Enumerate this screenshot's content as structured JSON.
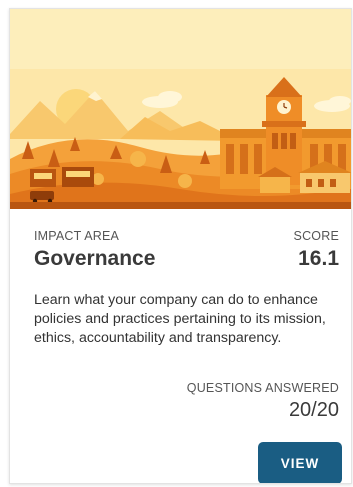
{
  "card": {
    "impact_area_label": "IMPACT AREA",
    "impact_area_title": "Governance",
    "score_label": "SCORE",
    "score_value": "16.1",
    "description": "Learn what your company can do to enhance policies and practices pertaining to its mission, ethics, accountability and transparency.",
    "questions_label": "QUESTIONS ANSWERED",
    "questions_value": "20/20",
    "view_button": "VIEW"
  },
  "colors": {
    "button_bg": "#1a5d83",
    "illustration_primary": "#f29a2e",
    "illustration_sky": "#fde7a9"
  },
  "illustration": {
    "icon": "town-landscape-illustration"
  }
}
